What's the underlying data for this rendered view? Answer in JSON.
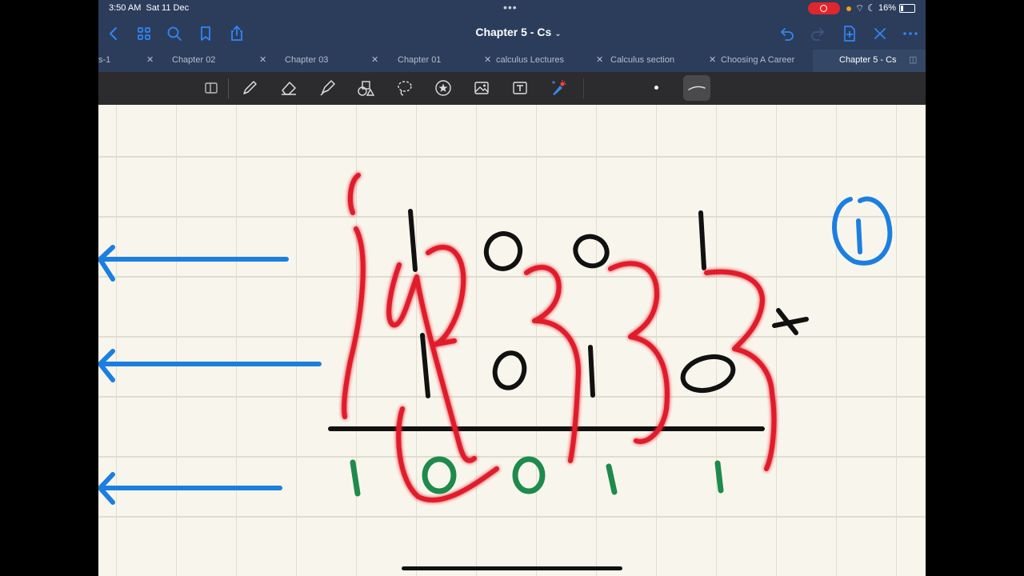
{
  "status_bar": {
    "time": "3:50 AM",
    "date": "Sat 11 Dec",
    "battery": "16%"
  },
  "nav_bar": {
    "title": "Chapter 5 - Cs",
    "icons": [
      "back-chevron-icon",
      "grid-icon",
      "search-icon",
      "bookmark-icon",
      "share-icon",
      "undo-icon",
      "redo-icon",
      "add-page-icon",
      "close-icon",
      "more-icon"
    ]
  },
  "tabs": [
    {
      "label": "s-1",
      "active": false
    },
    {
      "label": "Chapter 02",
      "active": false
    },
    {
      "label": "Chapter 03",
      "active": false
    },
    {
      "label": "Chapter 01",
      "active": false
    },
    {
      "label": "calculus Lectures",
      "active": false
    },
    {
      "label": "Calculus section",
      "active": false
    },
    {
      "label": "Choosing A Career",
      "active": false
    },
    {
      "label": "Chapter 5 - Cs",
      "active": true
    }
  ],
  "tools": [
    "split-view-icon",
    "pen-icon",
    "eraser-icon",
    "highlighter-icon",
    "shapes-icon",
    "lasso-icon",
    "sticker-icon",
    "image-icon",
    "text-icon",
    "laser-pointer-icon"
  ],
  "colors": {
    "accent": "#2f86f6",
    "ink_black": "#111111",
    "ink_red": "#e11a2a",
    "ink_green": "#1e8a4c",
    "ink_blue": "#1c7fe0"
  },
  "handwriting": {
    "top_row": [
      "1",
      "0",
      "0",
      "1"
    ],
    "middle_row": [
      "1",
      "0",
      "1",
      "0"
    ],
    "operator": "+",
    "result": [
      "1",
      "0",
      "0",
      "1",
      "1"
    ],
    "red_marks": [
      "1",
      "2",
      "3",
      "3",
      "3",
      "3"
    ],
    "circled_number": "1"
  }
}
